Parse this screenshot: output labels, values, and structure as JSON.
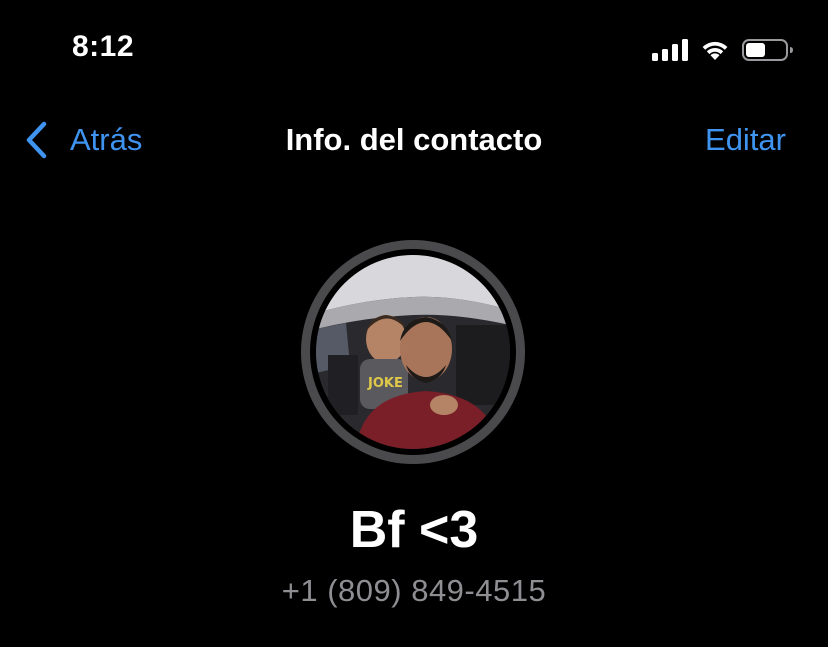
{
  "status_bar": {
    "time": "8:12",
    "signal_icon": "signal-bars-icon",
    "wifi_icon": "wifi-icon",
    "battery_icon": "battery-icon",
    "battery_level": 0.5
  },
  "nav": {
    "back_label": "Atrás",
    "back_icon": "chevron-left-icon",
    "title": "Info. del contacto",
    "edit_label": "Editar"
  },
  "contact": {
    "name": "Bf <3",
    "phone": "+1 (809) 849-4515",
    "avatar": "profile-photo"
  },
  "colors": {
    "background": "#000000",
    "accent": "#3f94f0",
    "secondary_text": "#8e8e93"
  }
}
